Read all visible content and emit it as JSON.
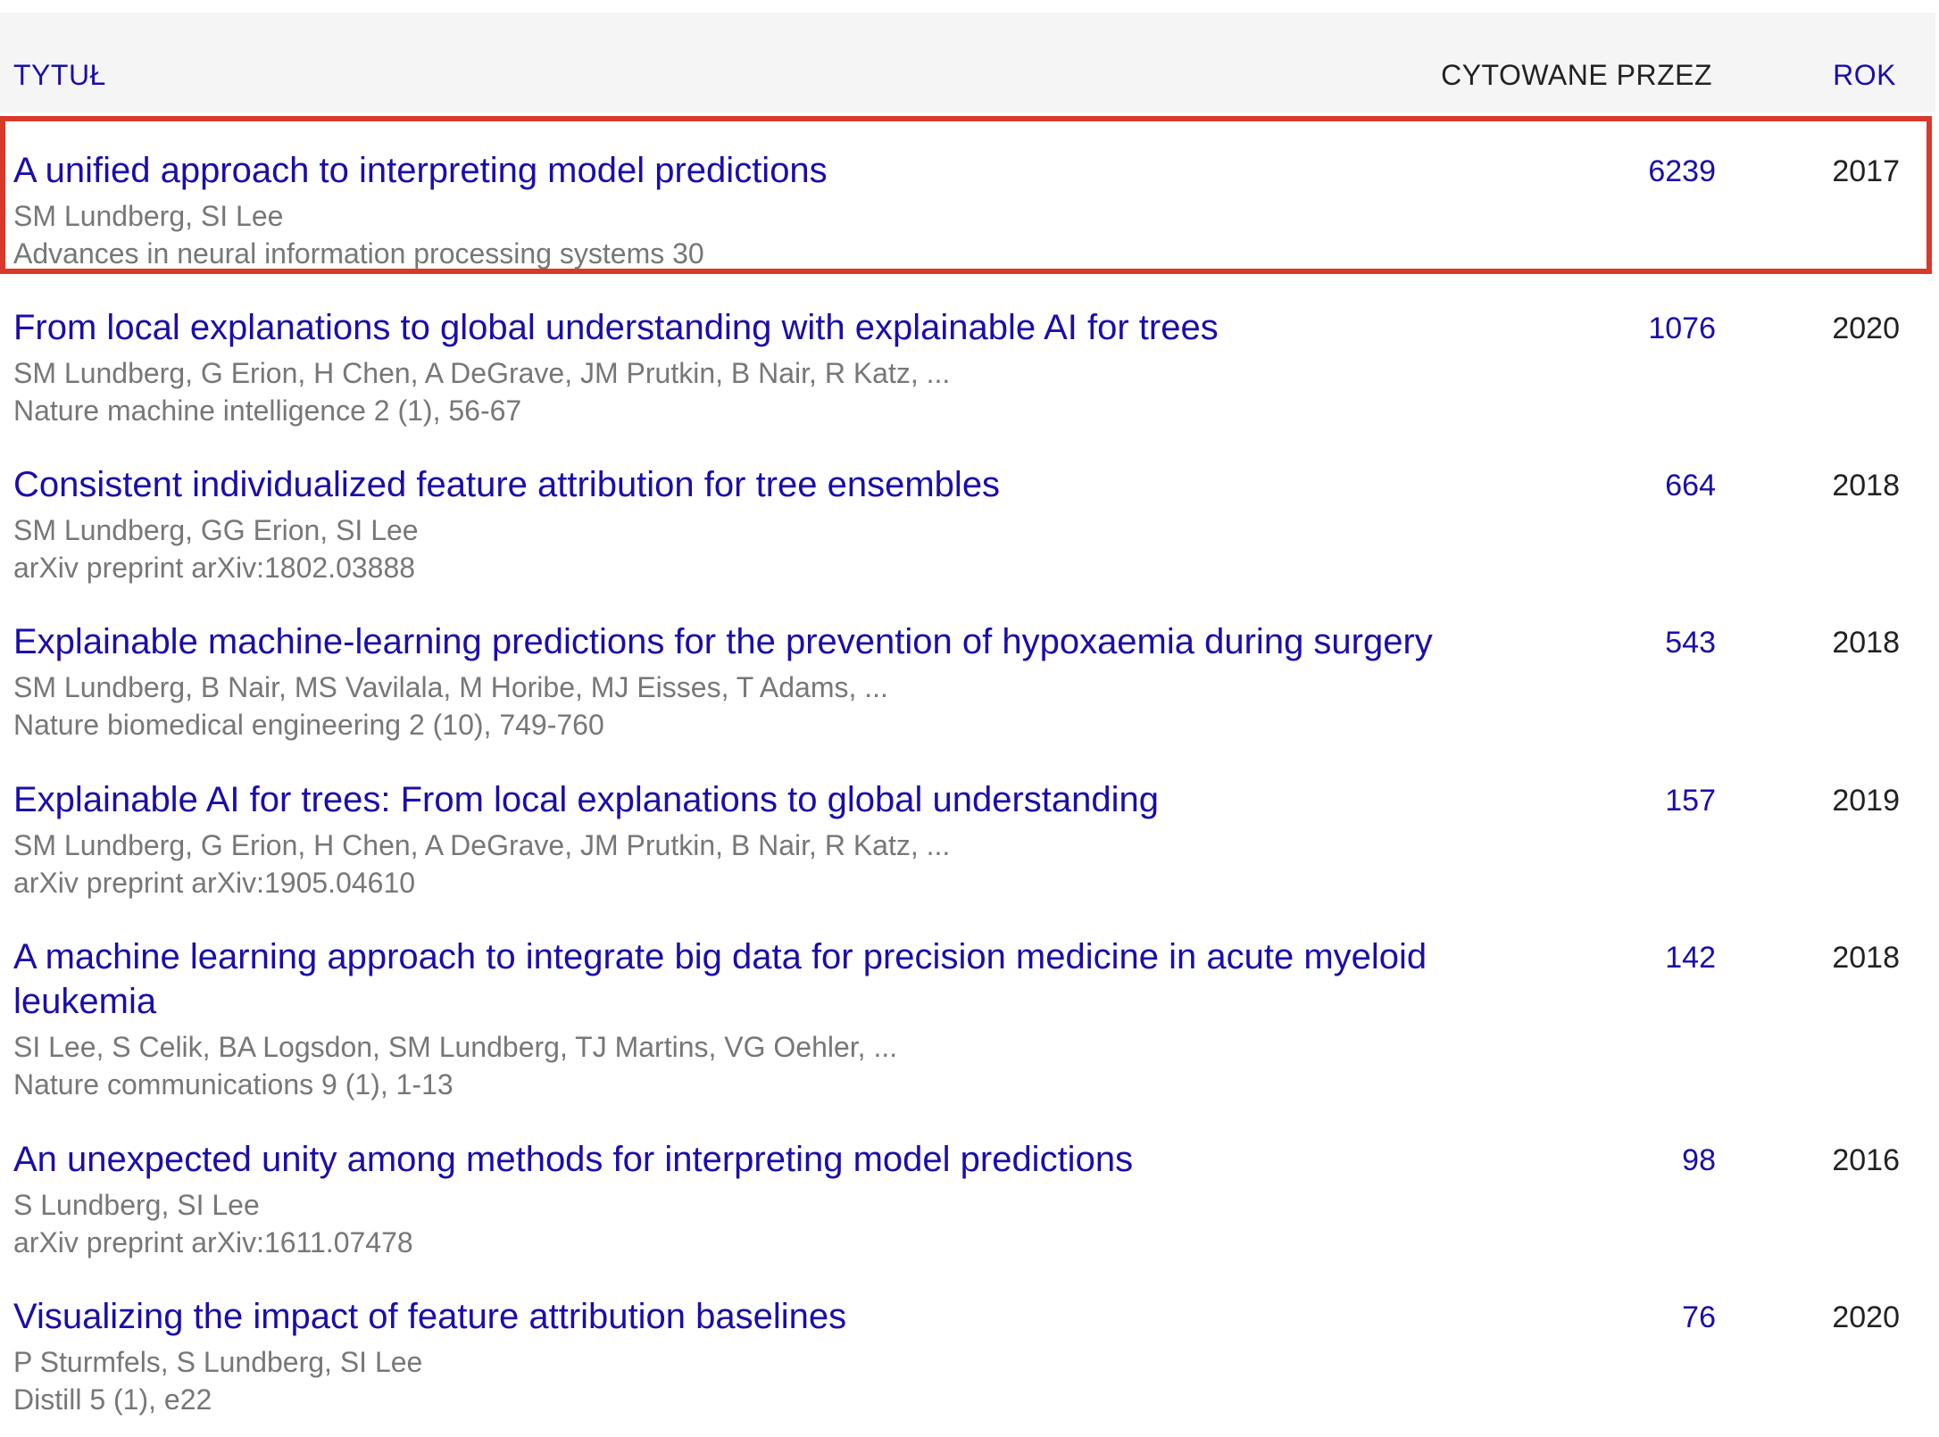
{
  "columns": {
    "title": "TYTUŁ",
    "cited_by": "CYTOWANE PRZEZ",
    "year": "ROK"
  },
  "highlight_color": "#d9392b",
  "link_color": "#1a0dab",
  "rows": [
    {
      "title": "A unified approach to interpreting model predictions",
      "authors": "SM Lundberg, SI Lee",
      "venue": "Advances in neural information processing systems 30",
      "cites": "6239",
      "year": "2017",
      "highlighted": true
    },
    {
      "title": "From local explanations to global understanding with explainable AI for trees",
      "authors": "SM Lundberg, G Erion, H Chen, A DeGrave, JM Prutkin, B Nair, R Katz, ...",
      "venue": "Nature machine intelligence 2 (1), 56-67",
      "cites": "1076",
      "year": "2020"
    },
    {
      "title": "Consistent individualized feature attribution for tree ensembles",
      "authors": "SM Lundberg, GG Erion, SI Lee",
      "venue": "arXiv preprint arXiv:1802.03888",
      "cites": "664",
      "year": "2018"
    },
    {
      "title": "Explainable machine-learning predictions for the prevention of hypoxaemia during surgery",
      "authors": "SM Lundberg, B Nair, MS Vavilala, M Horibe, MJ Eisses, T Adams, ...",
      "venue": "Nature biomedical engineering 2 (10), 749-760",
      "cites": "543",
      "year": "2018"
    },
    {
      "title": "Explainable AI for trees: From local explanations to global understanding",
      "authors": "SM Lundberg, G Erion, H Chen, A DeGrave, JM Prutkin, B Nair, R Katz, ...",
      "venue": "arXiv preprint arXiv:1905.04610",
      "cites": "157",
      "year": "2019"
    },
    {
      "title": "A machine learning approach to integrate big data for precision medicine in acute myeloid leukemia",
      "authors": "SI Lee, S Celik, BA Logsdon, SM Lundberg, TJ Martins, VG Oehler, ...",
      "venue": "Nature communications 9 (1), 1-13",
      "cites": "142",
      "year": "2018"
    },
    {
      "title": "An unexpected unity among methods for interpreting model predictions",
      "authors": "S Lundberg, SI Lee",
      "venue": "arXiv preprint arXiv:1611.07478",
      "cites": "98",
      "year": "2016"
    },
    {
      "title": "Visualizing the impact of feature attribution baselines",
      "authors": "P Sturmfels, S Lundberg, SI Lee",
      "venue": "Distill 5 (1), e22",
      "cites": "76",
      "year": "2020"
    }
  ]
}
